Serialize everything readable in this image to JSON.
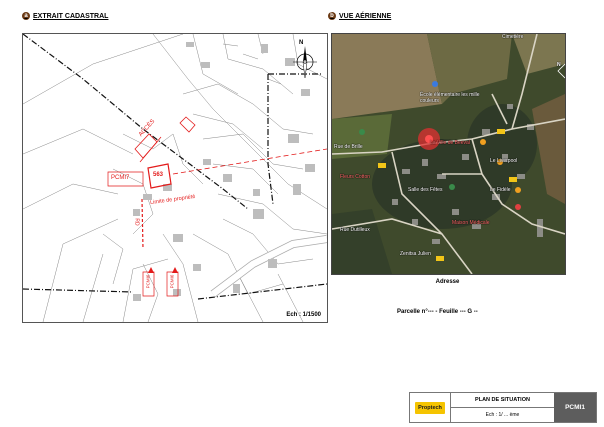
{
  "sections": {
    "cadastral": {
      "badge": "a",
      "title": "EXTRAIT CADASTRAL"
    },
    "aerial": {
      "badge": "b",
      "title": "VUE AÉRIENNE"
    }
  },
  "cadastral_map": {
    "parcel_number": "563",
    "pcmi_label": "PCMI7",
    "access_label": "ACCÈS",
    "limit_label": "Limite de propriété",
    "road_label_rd": "RD",
    "annotations_vertical": [
      "PCMI6",
      "PCMI6"
    ],
    "scale": "Ech : 1/1500",
    "north_letter": "N"
  },
  "aerial_map": {
    "labels": {
      "school": "École élémentaire les mille couleurs",
      "ville": "La Ville de Beeval",
      "salle": "Salle des Fêtes",
      "liverpool": "Le Liverpool",
      "fidele": "Le Fidèle",
      "fleurs": "Fleurs Cotton",
      "maison": "Maison Médicale",
      "zenitsa": "Zenitsa Julien",
      "cemetery": "Cimetière",
      "rue_left": "Rue de Brille",
      "rue_bottom": "Rue Dutilleux"
    },
    "north_letter": "N"
  },
  "adresse_label": "Adresse",
  "parcelle_line": "Parcelle n°---   - Feuille  --- G --",
  "cartouche": {
    "logo": "Proptech",
    "title": "PLAN DE SITUATION",
    "scale": "Ech : 1/ ... ème",
    "code": "PCMI1"
  },
  "colors": {
    "badge": "#6b3a14",
    "annotation_red": "#e31b1b",
    "logo_yellow": "#f5c400",
    "code_bg": "#5d5d5d"
  }
}
